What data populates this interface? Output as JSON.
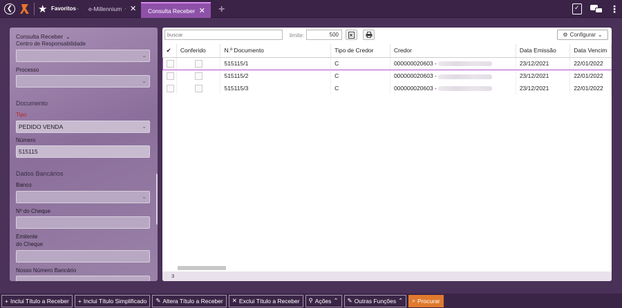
{
  "topbar": {
    "favorites_label": "Favoritos",
    "favorites_dash": "-",
    "tab_inactive_label": "e-Millennium",
    "tab_inactive_dash": "-",
    "tab_active_label": "Consulta Receber",
    "close_glyph": "✕",
    "add_glyph": "+"
  },
  "left_panel": {
    "title": "Consulta Receber",
    "cut_label": "Centro de Responsabilidade",
    "processo_label": "Processo",
    "documento_section": "Documento",
    "tipo_label": "Tipo",
    "tipo_value": "PEDIDO VENDA",
    "numero_label": "Número",
    "numero_value": "515115",
    "dados_bancarios_section": "Dados Bancários",
    "banco_label": "Banco",
    "cheque_label": "Nº do Cheque",
    "emitente_label_1": "Emitente",
    "emitente_label_2": "do Cheque",
    "nosso_numero_label": "Nosso Número Bancário"
  },
  "toolbar": {
    "search_placeholder": "buscar",
    "limit_label": "limite:",
    "limit_value": "500",
    "config_label": "Configurar"
  },
  "table": {
    "headers": {
      "select": "✔",
      "conferido": "Conferido",
      "documento": "N.º Documento",
      "tipo_credor": "Tipo de Credor",
      "credor": "Credor",
      "data_emissao": "Data Emissão",
      "data_venc": "Data Vencim"
    },
    "rows": [
      {
        "documento": "515115/1",
        "tipo_credor": "C",
        "credor": "000000020603 -",
        "data_emissao": "23/12/2021",
        "data_venc": "22/01/2022"
      },
      {
        "documento": "515115/2",
        "tipo_credor": "C",
        "credor": "000000020603 -",
        "data_emissao": "23/12/2021",
        "data_venc": "22/01/2022"
      },
      {
        "documento": "515115/3",
        "tipo_credor": "C",
        "credor": "000000020603 -",
        "data_emissao": "23/12/2021",
        "data_venc": "22/01/2022"
      }
    ],
    "record_count": "3"
  },
  "actions": {
    "inclui_titulo": "Inclui Título a Receber",
    "inclui_simplificado": "Inclui Título Simplificado",
    "altera_titulo": "Altera Título a Receber",
    "exclui_titulo": "Exclui Título a Receber",
    "acoes": "Ações",
    "outras_funcoes": "Outras Funções",
    "procurar": "Procurar"
  },
  "colors": {
    "accent_purple": "#8e51a8",
    "selection_border": "#b04fd0",
    "primary_orange": "#e07a2e",
    "required_red": "#c0202a"
  }
}
